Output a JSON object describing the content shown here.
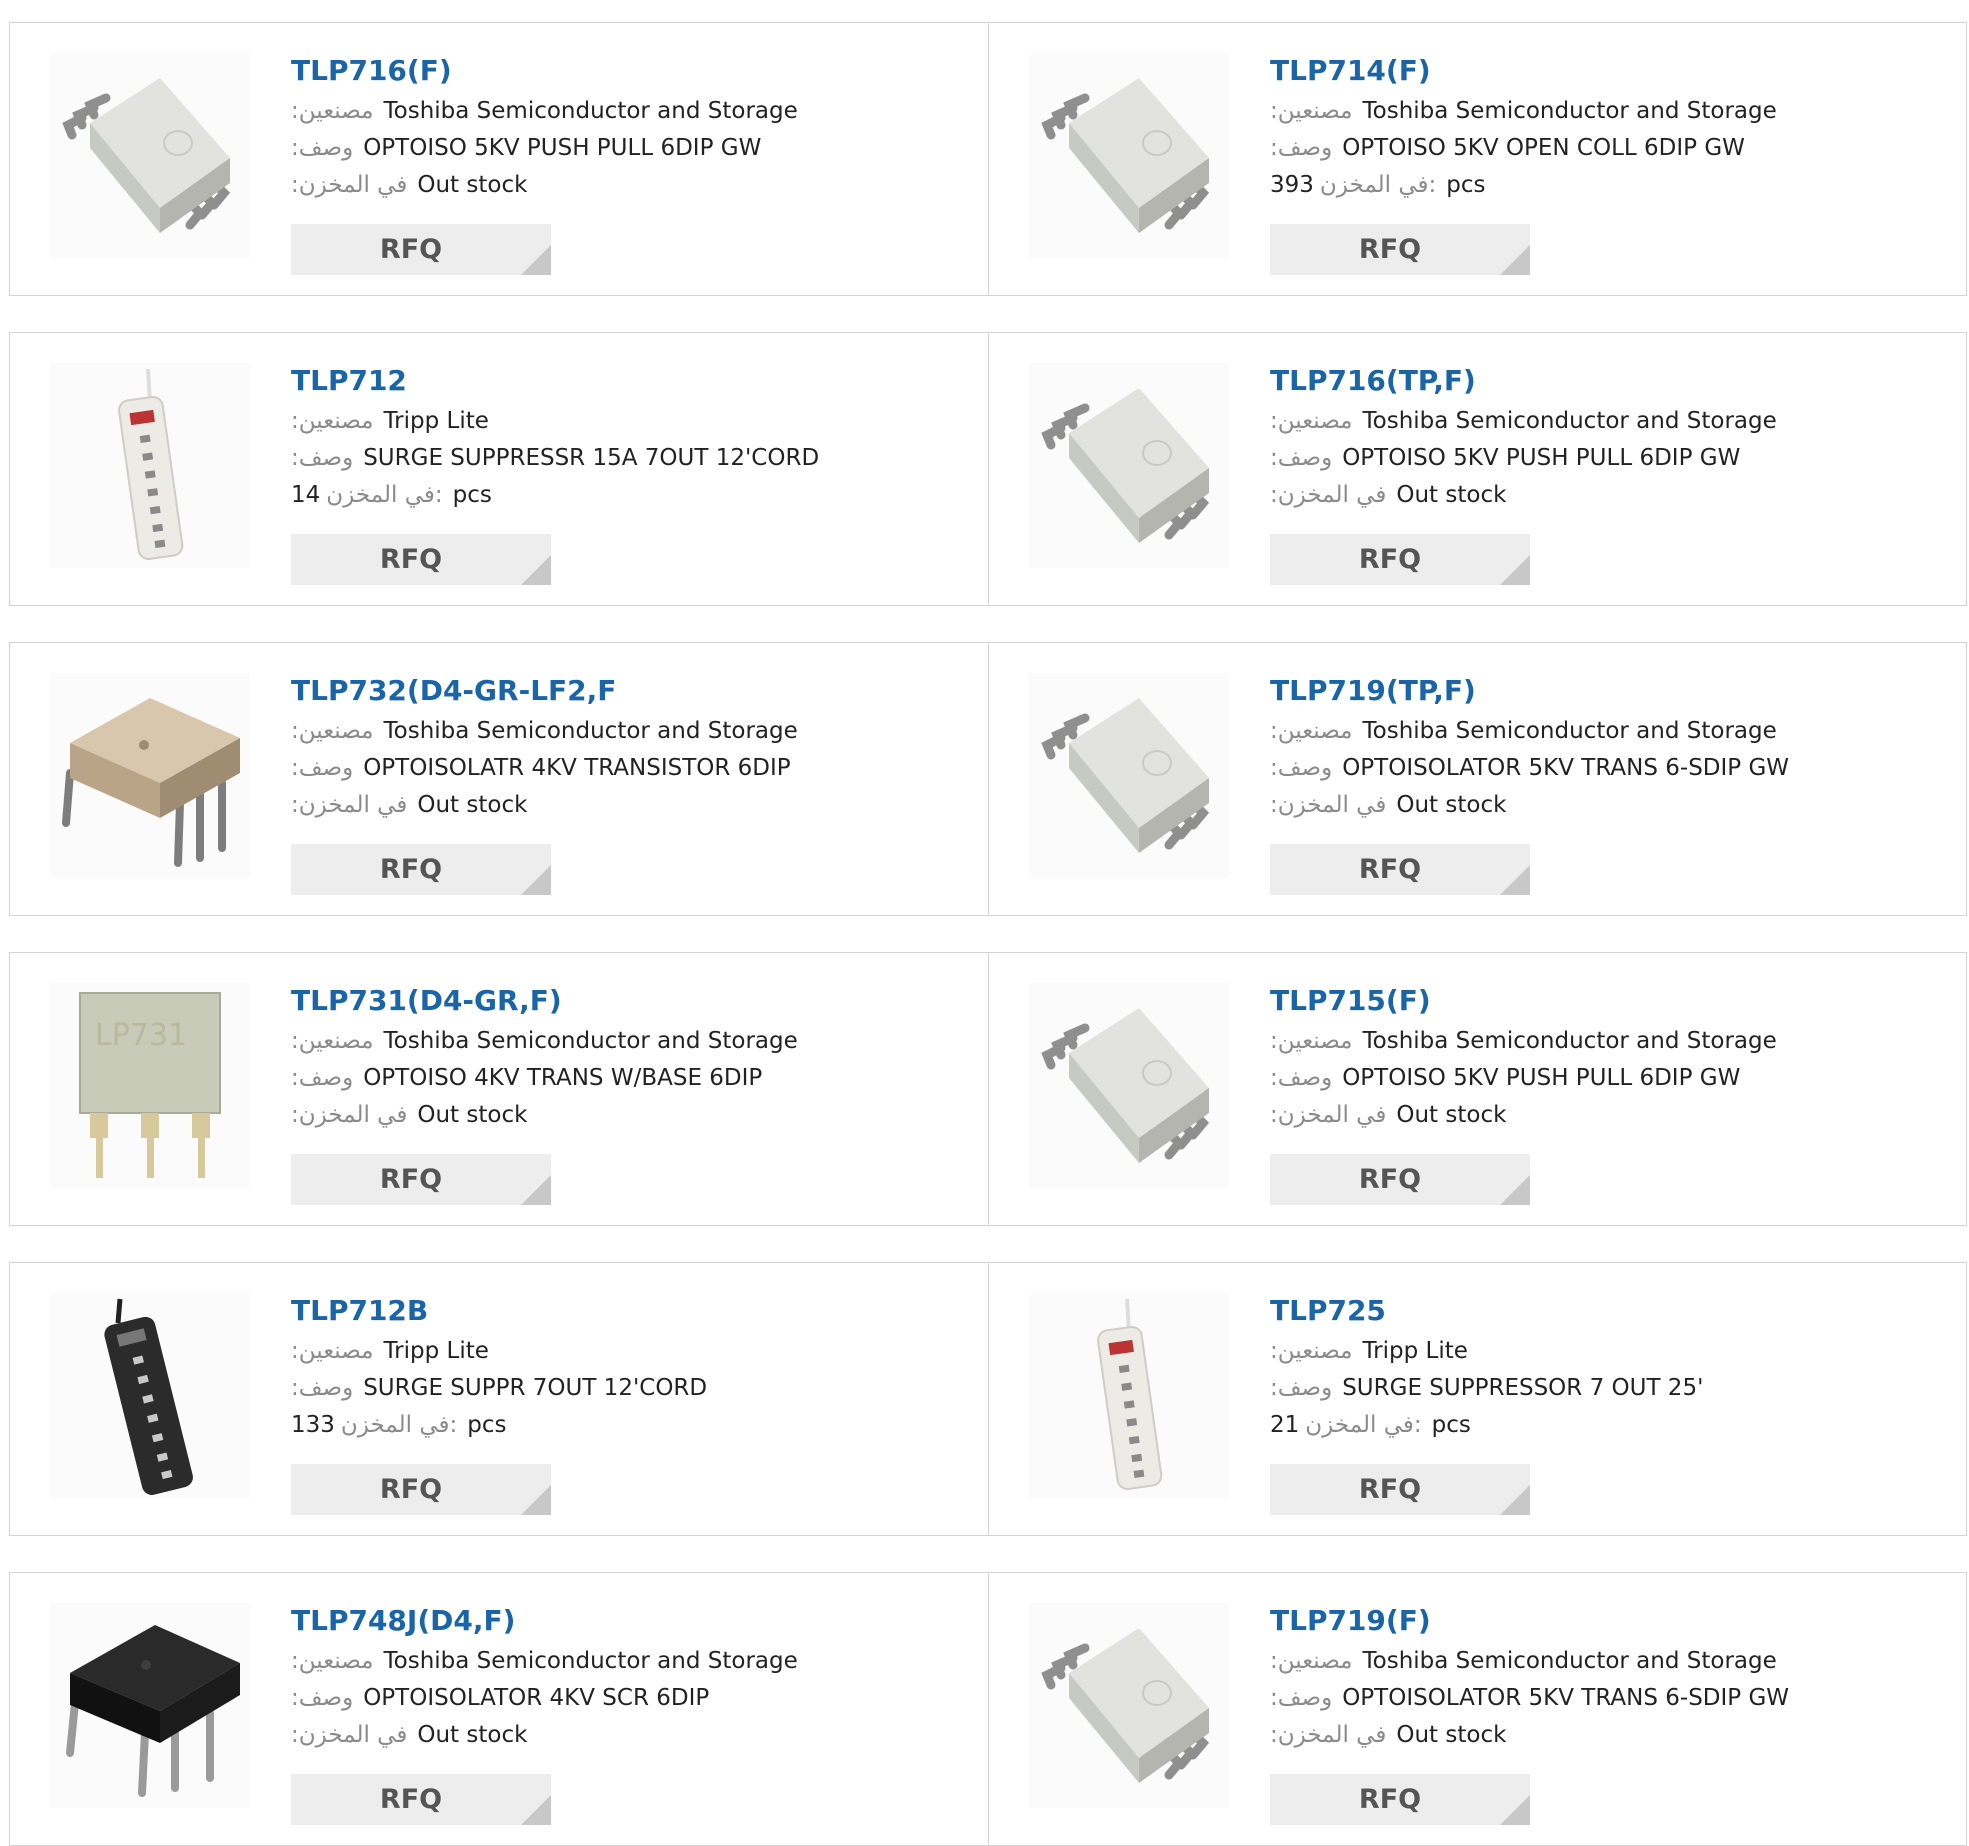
{
  "labels": {
    "manufacturer": ":مصنعين",
    "description": ":وصف",
    "stock": ":في المخزن",
    "stock_qty": "في المخزن:",
    "pcs": "pcs",
    "rfq": "RFQ"
  },
  "products": [
    {
      "name": "TLP716(F)",
      "manufacturer": "Toshiba Semiconductor and Storage",
      "description": "OPTOISO 5KV PUSH PULL 6DIP GW",
      "stock": "Out stock",
      "qty": null,
      "image": "sdip-white-package-icon"
    },
    {
      "name": "TLP714(F)",
      "manufacturer": "Toshiba Semiconductor and Storage",
      "description": "OPTOISO 5KV OPEN COLL 6DIP GW",
      "stock": null,
      "qty": "393",
      "image": "sdip-white-package-icon"
    },
    {
      "name": "TLP712",
      "manufacturer": "Tripp Lite",
      "description": "SURGE SUPPRESSR 15A 7OUT 12'CORD",
      "stock": null,
      "qty": "14",
      "image": "power-strip-white-icon"
    },
    {
      "name": "TLP716(TP,F)",
      "manufacturer": "Toshiba Semiconductor and Storage",
      "description": "OPTOISO 5KV PUSH PULL 6DIP GW",
      "stock": "Out stock",
      "qty": null,
      "image": "sdip-white-package-icon"
    },
    {
      "name": "TLP732(D4-GR-LF2,F",
      "manufacturer": "Toshiba Semiconductor and Storage",
      "description": "OPTOISOLATR 4KV TRANSISTOR 6DIP",
      "stock": "Out stock",
      "qty": null,
      "image": "dip-beige-package-icon"
    },
    {
      "name": "TLP719(TP,F)",
      "manufacturer": "Toshiba Semiconductor and Storage",
      "description": "OPTOISOLATOR 5KV TRANS 6-SDIP GW",
      "stock": "Out stock",
      "qty": null,
      "image": "sdip-white-package-icon"
    },
    {
      "name": "TLP731(D4-GR,F)",
      "manufacturer": "Toshiba Semiconductor and Storage",
      "description": "OPTOISO 4KV TRANS W/BASE 6DIP",
      "stock": "Out stock",
      "qty": null,
      "image": "dip-gray-package-icon"
    },
    {
      "name": "TLP715(F)",
      "manufacturer": "Toshiba Semiconductor and Storage",
      "description": "OPTOISO 5KV PUSH PULL 6DIP GW",
      "stock": "Out stock",
      "qty": null,
      "image": "sdip-white-package-icon"
    },
    {
      "name": "TLP712B",
      "manufacturer": "Tripp Lite",
      "description": "SURGE SUPPR 7OUT 12'CORD",
      "stock": null,
      "qty": "133",
      "image": "power-strip-black-icon"
    },
    {
      "name": "TLP725",
      "manufacturer": "Tripp Lite",
      "description": "SURGE SUPPRESSOR 7 OUT 25'",
      "stock": null,
      "qty": "21",
      "image": "power-strip-white-icon"
    },
    {
      "name": "TLP748J(D4,F)",
      "manufacturer": "Toshiba Semiconductor and Storage",
      "description": "OPTOISOLATOR 4KV SCR 6DIP",
      "stock": "Out stock",
      "qty": null,
      "image": "dip-black-package-icon"
    },
    {
      "name": "TLP719(F)",
      "manufacturer": "Toshiba Semiconductor and Storage",
      "description": "OPTOISOLATOR 5KV TRANS 6-SDIP GW",
      "stock": "Out stock",
      "qty": null,
      "image": "sdip-white-package-icon"
    }
  ]
}
